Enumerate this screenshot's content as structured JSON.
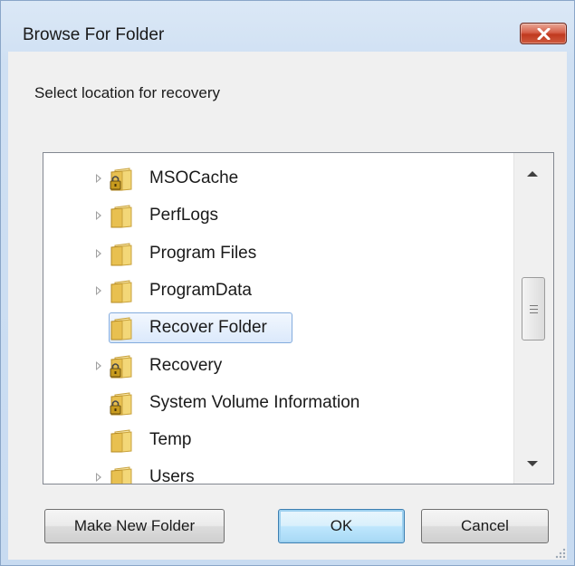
{
  "window": {
    "title": "Browse For Folder",
    "close_icon": "close-x-icon"
  },
  "prompt": "Select location for recovery",
  "tree": {
    "items": [
      {
        "label": "MSOCache",
        "expandable": true,
        "locked": true,
        "selected": false
      },
      {
        "label": "PerfLogs",
        "expandable": true,
        "locked": false,
        "selected": false
      },
      {
        "label": "Program Files",
        "expandable": true,
        "locked": false,
        "selected": false
      },
      {
        "label": "ProgramData",
        "expandable": true,
        "locked": false,
        "selected": false
      },
      {
        "label": "Recover Folder",
        "expandable": false,
        "locked": false,
        "selected": true
      },
      {
        "label": "Recovery",
        "expandable": true,
        "locked": true,
        "selected": false
      },
      {
        "label": "System Volume Information",
        "expandable": false,
        "locked": true,
        "selected": false
      },
      {
        "label": "Temp",
        "expandable": false,
        "locked": false,
        "selected": false
      },
      {
        "label": "Users",
        "expandable": true,
        "locked": false,
        "selected": false
      }
    ]
  },
  "buttons": {
    "make_new_folder": "Make New Folder",
    "ok": "OK",
    "cancel": "Cancel"
  },
  "colors": {
    "folder": "#e8c050",
    "lock": "#c89b1e",
    "selection_border": "#84acdd",
    "close_button": "#c0391f"
  }
}
